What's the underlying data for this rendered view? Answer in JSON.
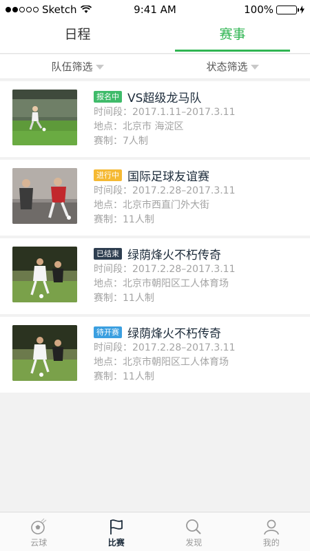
{
  "status_bar": {
    "carrier": "Sketch",
    "time": "9:41 AM",
    "battery_text": "100%",
    "battery_level": 1.0,
    "signal_bars_filled": 2,
    "signal_bars_total": 5
  },
  "tabs": [
    {
      "label": "日程",
      "active": false
    },
    {
      "label": "赛事",
      "active": true
    }
  ],
  "accent_color": "#2fb552",
  "filters": [
    {
      "label": "队伍筛选"
    },
    {
      "label": "状态筛选"
    }
  ],
  "events": [
    {
      "badge": "报名中",
      "badge_color": "#3fbb6a",
      "title": "VS超级龙马队",
      "period": "时间段：2017.1.11–2017.3.11",
      "location": "地点：北京市 海淀区",
      "format": "赛制：7人制",
      "image_icon": "soccer-player-photo"
    },
    {
      "badge": "进行中",
      "badge_color": "#f5b933",
      "title": "国际足球友谊赛",
      "period": "时间段：2017.2.28–2017.3.11",
      "location": "地点：北京市西直门外大街",
      "format": "赛制：11人制",
      "image_icon": "soccer-player-photo"
    },
    {
      "badge": "已结束",
      "badge_color": "#2e3e50",
      "title": "绿荫烽火不朽传奇",
      "period": "时间段：2017.2.28–2017.3.11",
      "location": "地点：北京市朝阳区工人体育场",
      "format": "赛制：11人制",
      "image_icon": "soccer-player-photo"
    },
    {
      "badge": "待开赛",
      "badge_color": "#3b9fe0",
      "title": "绿荫烽火不朽传奇",
      "period": "时间段：2017.2.28–2017.3.11",
      "location": "地点：北京市朝阳区工人体育场",
      "format": "赛制：11人制",
      "image_icon": "soccer-player-photo"
    }
  ],
  "bottom_nav": [
    {
      "label": "云球",
      "icon": "soccer-ball-icon",
      "active": false
    },
    {
      "label": "比赛",
      "icon": "flag-icon",
      "active": true
    },
    {
      "label": "发现",
      "icon": "search-icon",
      "active": false
    },
    {
      "label": "我的",
      "icon": "user-icon",
      "active": false
    }
  ]
}
